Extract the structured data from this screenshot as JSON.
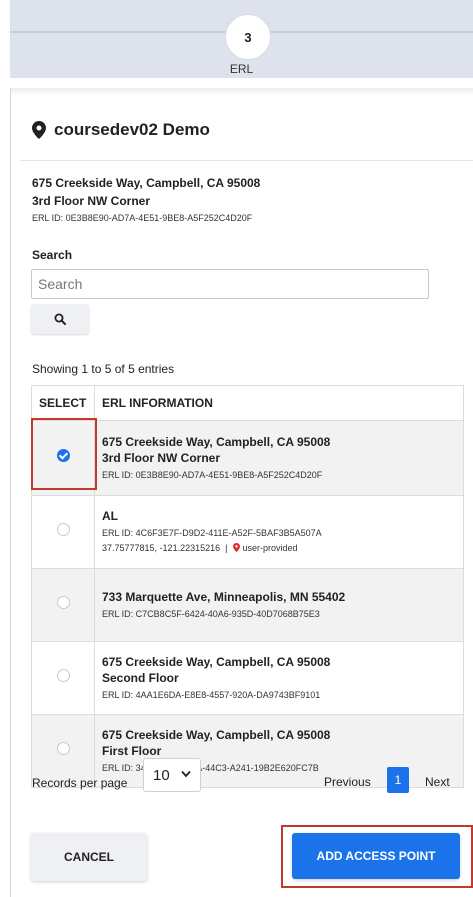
{
  "stepper": {
    "step_number": "3",
    "step_label": "ERL"
  },
  "site": {
    "title": "coursedev02 Demo",
    "address_line1": "675 Creekside Way, Campbell, CA 95008",
    "address_line2": "3rd Floor NW Corner",
    "erl_id": "ERL ID: 0E3B8E90-AD7A-4E51-9BE8-A5F252C4D20F"
  },
  "search": {
    "label": "Search",
    "placeholder": "Search",
    "value": ""
  },
  "table": {
    "showing_text": "Showing 1 to 5 of 5 entries",
    "headers": [
      "SELECT",
      "ERL INFORMATION"
    ],
    "rows": [
      {
        "selected": true,
        "line1": "675 Creekside Way, Campbell, CA 95008",
        "line2": "3rd Floor NW Corner",
        "erl": "ERL ID: 0E3B8E90-AD7A-4E51-9BE8-A5F252C4D20F"
      },
      {
        "selected": false,
        "line1": "AL",
        "line2": "",
        "erl": "ERL ID: 4C6F3E7F-D9D2-411E-A52F-5BAF3B5A507A",
        "coords": "37.75777815, -121.22315216",
        "coords_sep": "|",
        "source": "user-provided"
      },
      {
        "selected": false,
        "line1": "733 Marquette Ave, Minneapolis, MN 55402",
        "line2": "",
        "erl": "ERL ID: C7CB8C5F-6424-40A6-935D-40D7068B75E3"
      },
      {
        "selected": false,
        "line1": "675 Creekside Way, Campbell, CA 95008",
        "line2": "Second Floor",
        "erl": "ERL ID: 4AA1E6DA-E8E8-4557-920A-DA9743BF9101"
      },
      {
        "selected": false,
        "line1": "675 Creekside Way, Campbell, CA 95008",
        "line2": "First Floor",
        "erl": "ERL ID: 3408084E-C96A-44C3-A241-19B2E620FC7B"
      }
    ]
  },
  "pagination": {
    "records_label": "Records per page",
    "records_value": "10",
    "previous": "Previous",
    "current_page": "1",
    "next": "Next"
  },
  "actions": {
    "cancel": "CANCEL",
    "add": "ADD ACCESS POINT"
  },
  "colors": {
    "accent": "#1a73e8",
    "highlight": "#c0392b",
    "stepper_bg": "#dde2ec"
  }
}
